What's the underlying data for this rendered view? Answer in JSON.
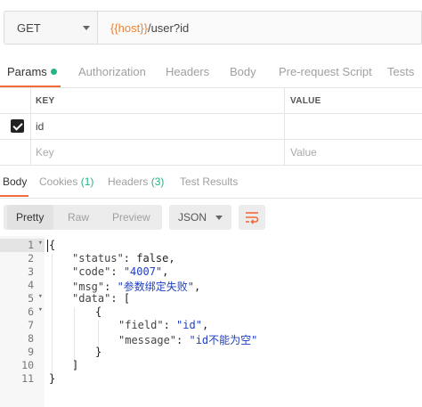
{
  "request": {
    "method": "GET",
    "url_variable": "{{host}}",
    "url_path": "/user?id"
  },
  "request_tabs": [
    {
      "label": "Params",
      "active": true
    },
    {
      "label": "Authorization",
      "active": false
    },
    {
      "label": "Headers",
      "active": false
    },
    {
      "label": "Body",
      "active": false
    },
    {
      "label": "Pre-request Script",
      "active": false
    },
    {
      "label": "Tests",
      "active": false
    }
  ],
  "params_table": {
    "columns": [
      "KEY",
      "VALUE"
    ],
    "rows": [
      {
        "checked": true,
        "key": "id",
        "value": ""
      }
    ],
    "new_row": {
      "key_placeholder": "Key",
      "value_placeholder": "Value"
    }
  },
  "response_tabs": [
    {
      "label": "Body",
      "count": "",
      "active": true
    },
    {
      "label": "Cookies",
      "count": "(1)",
      "active": false
    },
    {
      "label": "Headers",
      "count": "(3)",
      "active": false
    },
    {
      "label": "Test Results",
      "count": "",
      "active": false
    }
  ],
  "view_modes": [
    {
      "label": "Pretty",
      "active": true
    },
    {
      "label": "Raw",
      "active": false
    },
    {
      "label": "Preview",
      "active": false
    }
  ],
  "format": "JSON",
  "icons": {
    "method_caret": "chevron-down-icon",
    "format_caret": "chevron-down-icon",
    "wrap": "wrap-lines-icon",
    "checkbox": "checkbox-checked-icon"
  },
  "colors": {
    "accent": "#f26b3a",
    "green": "#26b47f",
    "var": "#e8853b",
    "string": "#1f3fbf"
  },
  "code": {
    "line_numbers": [
      "1",
      "2",
      "3",
      "4",
      "5",
      "6",
      "7",
      "8",
      "9",
      "10",
      "11"
    ],
    "lines": [
      {
        "text": "{",
        "fold": true
      },
      {
        "key": "\"status\"",
        "sep": ": ",
        "value": "false,",
        "value_type": "literal",
        "fold": false
      },
      {
        "key": "\"code\"",
        "sep": ": ",
        "value": "\"4007\"",
        "tail": ",",
        "value_type": "string",
        "fold": false
      },
      {
        "key": "\"msg\"",
        "sep": ": ",
        "value": "\"参数绑定失败\"",
        "tail": ",",
        "value_type": "string",
        "fold": false
      },
      {
        "key": "\"data\"",
        "sep": ": ",
        "value": "[",
        "value_type": "literal",
        "fold": true
      },
      {
        "text": "{",
        "fold": true
      },
      {
        "key": "\"field\"",
        "sep": ": ",
        "value": "\"id\"",
        "tail": ",",
        "value_type": "string",
        "fold": false
      },
      {
        "key": "\"message\"",
        "sep": ": ",
        "value": "\"id不能为空\"",
        "value_type": "string",
        "fold": false
      },
      {
        "text": "}",
        "fold": false
      },
      {
        "text": "]",
        "fold": false
      },
      {
        "text": "}",
        "fold": false
      }
    ]
  }
}
